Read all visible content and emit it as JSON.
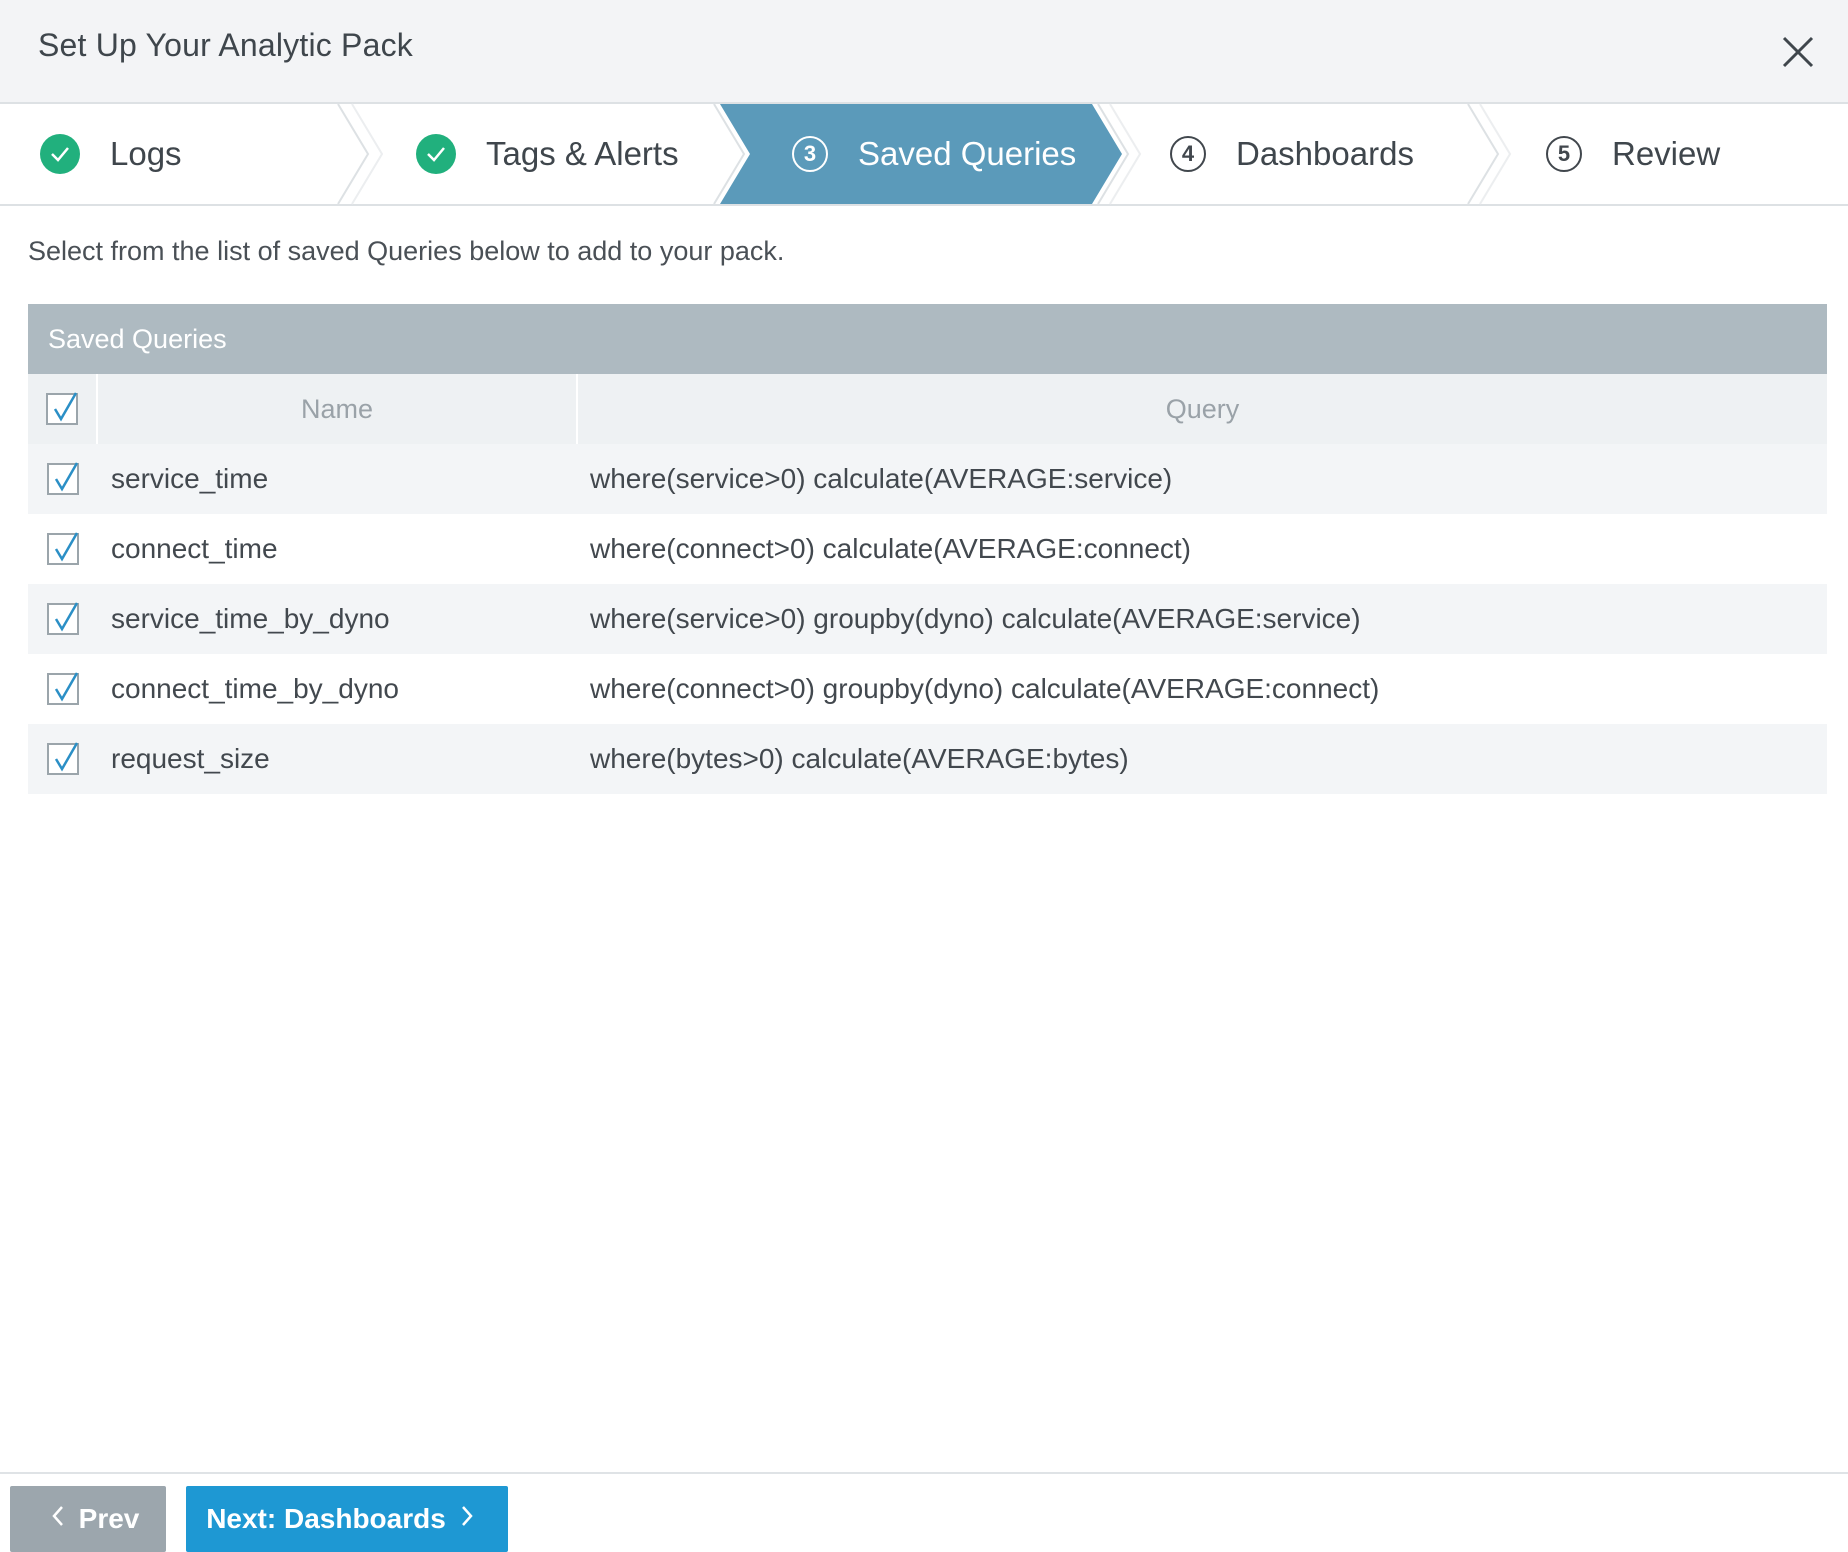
{
  "header": {
    "title": "Set Up Your Analytic Pack"
  },
  "steps": [
    {
      "label": "Logs",
      "status": "complete"
    },
    {
      "number": "3",
      "label": "Saved Queries",
      "status": "active"
    },
    {
      "label": "Tags & Alerts",
      "status": "complete"
    },
    {
      "number": "4",
      "label": "Dashboards",
      "status": "pending"
    },
    {
      "number": "5",
      "label": "Review",
      "status": "pending"
    }
  ],
  "intro": "Select from the list of saved Queries below to add to your pack.",
  "table": {
    "title": "Saved Queries",
    "columns": {
      "name": "Name",
      "query": "Query"
    },
    "select_all_checked": true,
    "rows": [
      {
        "checked": true,
        "name": "service_time",
        "query": "where(service>0) calculate(AVERAGE:service)"
      },
      {
        "checked": true,
        "name": "connect_time",
        "query": "where(connect>0) calculate(AVERAGE:connect)"
      },
      {
        "checked": true,
        "name": "service_time_by_dyno",
        "query": "where(service>0) groupby(dyno) calculate(AVERAGE:service)"
      },
      {
        "checked": true,
        "name": "connect_time_by_dyno",
        "query": "where(connect>0) groupby(dyno) calculate(AVERAGE:connect)"
      },
      {
        "checked": true,
        "name": "request_size",
        "query": "where(bytes>0) calculate(AVERAGE:bytes)"
      }
    ]
  },
  "footer": {
    "prev_label": "Prev",
    "next_label": "Next: Dashboards"
  },
  "colors": {
    "active_step": "#5b9aba",
    "complete_check": "#21b07d",
    "table_header": "#aebac1",
    "next_button": "#1e98d3",
    "prev_button": "#9ca6ad",
    "checkbox_tick": "#2b8fc6"
  },
  "icons": {
    "close": "close-icon",
    "complete": "checkmark-icon",
    "prev": "chevron-left-icon",
    "next": "chevron-right-icon"
  }
}
